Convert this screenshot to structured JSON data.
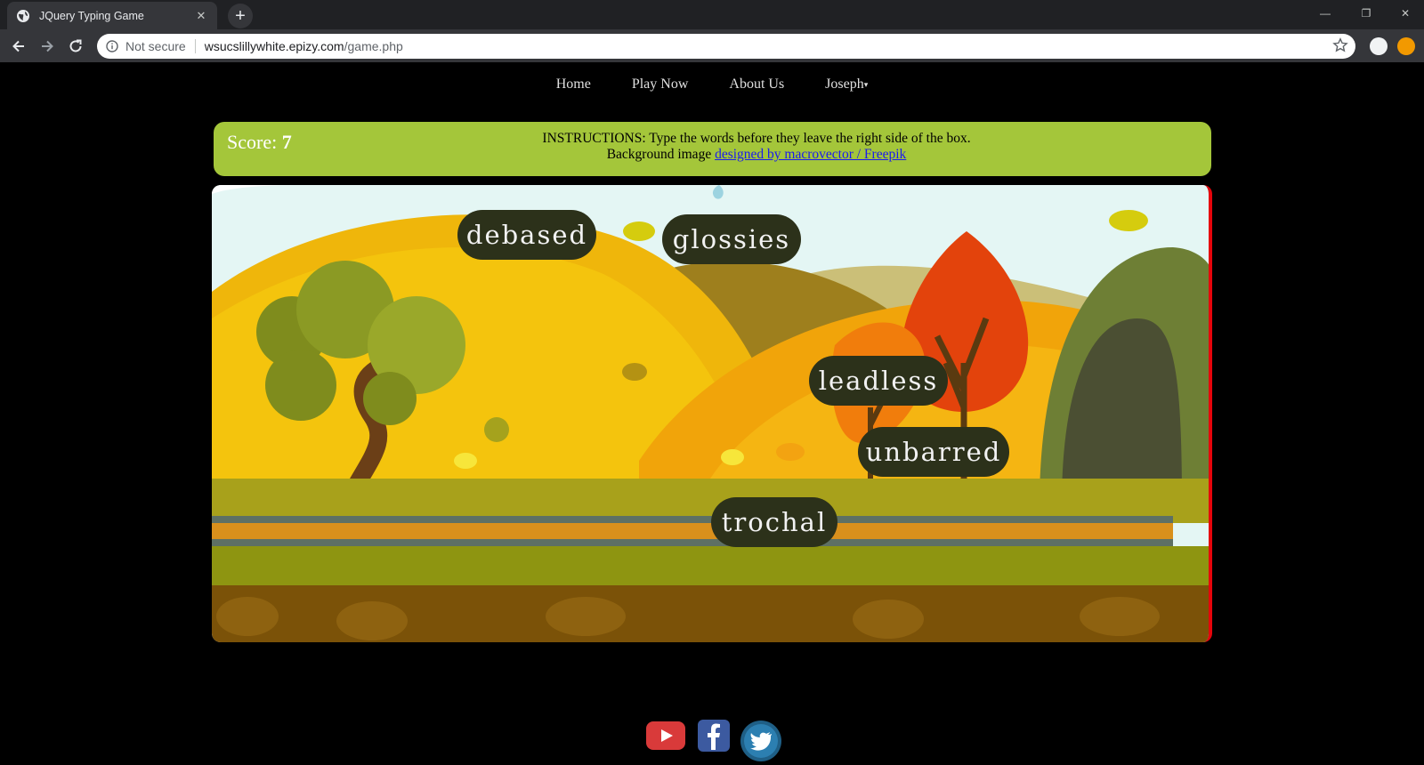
{
  "browser": {
    "tab_title": "JQuery Typing Game",
    "tab_close": "✕",
    "new_tab": "+",
    "security_label": "Not secure",
    "url_host": "wsucslillywhite.epizy.com",
    "url_path": "/game.php",
    "window_controls": [
      "—",
      "❐",
      "✕"
    ]
  },
  "nav": {
    "items": [
      "Home",
      "Play Now",
      "About Us"
    ],
    "user": "Joseph",
    "user_caret": "▾"
  },
  "info": {
    "score_label": "Score:",
    "score_value": "7",
    "instructions": "INSTRUCTIONS: Type the words before they leave the right side of the box.",
    "credit_prefix": "Background image",
    "credit_link": "designed by macrovector / Freepik"
  },
  "game": {
    "words": [
      "debased",
      "glossies",
      "leadless",
      "unbarred",
      "trochal"
    ],
    "limit_color": "#e5040b"
  },
  "social": {
    "icons": [
      "youtube-icon",
      "facebook-icon",
      "twitter-icon"
    ]
  }
}
